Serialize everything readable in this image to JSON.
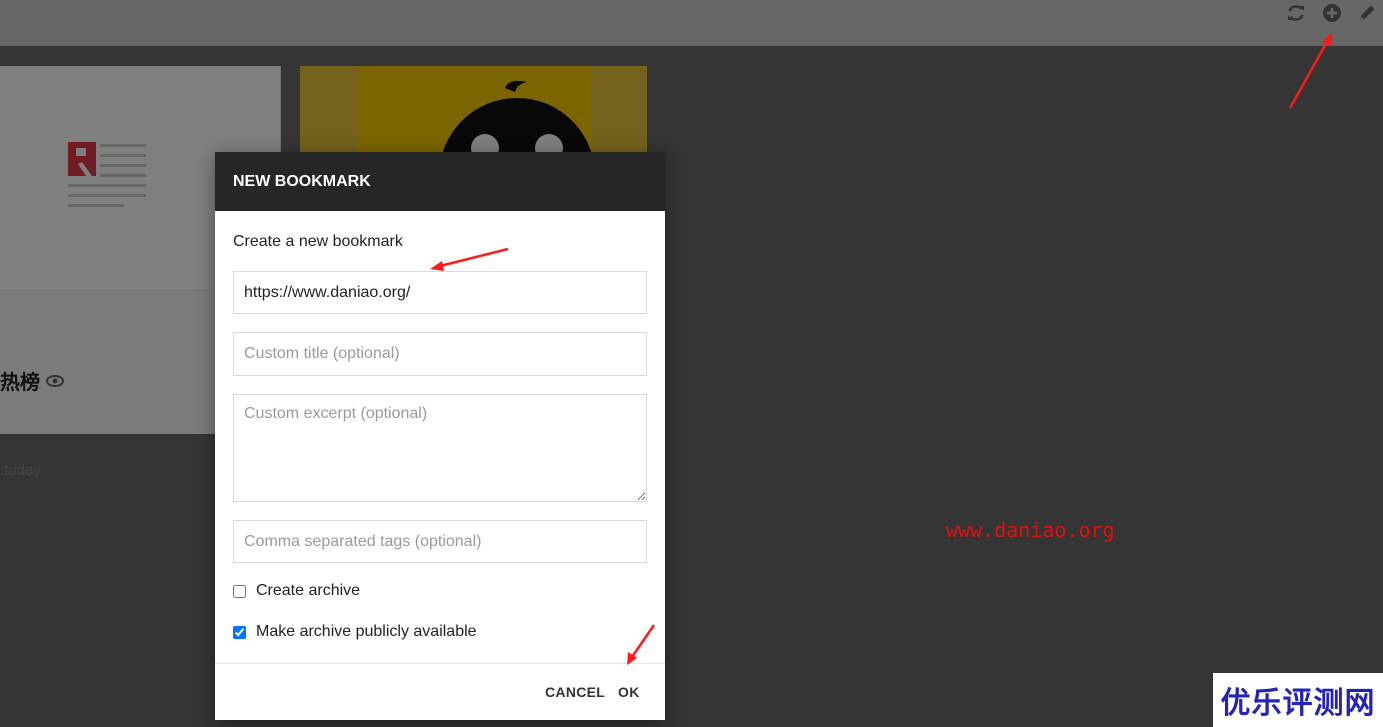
{
  "background": {
    "card1": {
      "title": "热榜",
      "host": ".today"
    }
  },
  "dialog": {
    "title": "NEW BOOKMARK",
    "subtitle": "Create a new bookmark",
    "url_value": "https://www.daniao.org/",
    "title_placeholder": "Custom title (optional)",
    "excerpt_placeholder": "Custom excerpt (optional)",
    "tags_placeholder": "Comma separated tags (optional)",
    "create_archive_label": "Create archive",
    "create_archive_checked": false,
    "public_archive_label": "Make archive publicly available",
    "public_archive_checked": true,
    "cancel_label": "CANCEL",
    "ok_label": "OK"
  },
  "toolbar": {
    "icons": [
      "refresh-icon",
      "add-circle-icon",
      "pencil-icon"
    ]
  },
  "annotations": {
    "watermark": "www.daniao.org",
    "corner_logo": "优乐评测网",
    "arrow_color": "#ff1a1a"
  },
  "colors": {
    "header_bg": "#262626",
    "watermark": "#e01010",
    "logo_text": "#2323b8"
  }
}
